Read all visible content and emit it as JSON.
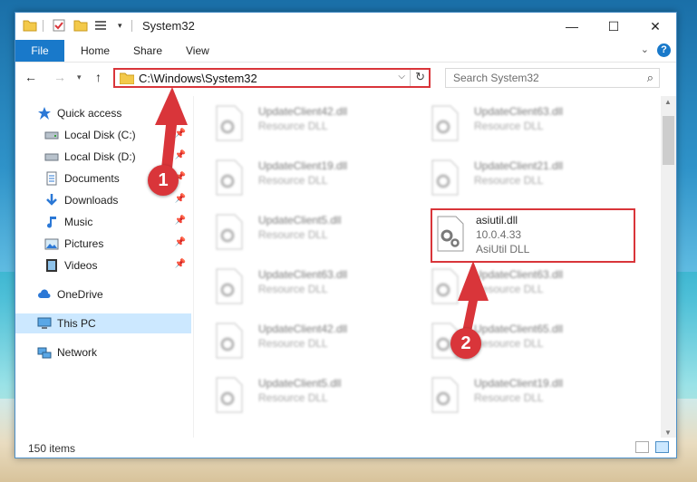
{
  "window": {
    "title": "System32",
    "controls": {
      "minimize": "—",
      "maximize": "☐",
      "close": "✕"
    }
  },
  "ribbon": {
    "file": "File",
    "tabs": [
      "Home",
      "Share",
      "View"
    ],
    "help": "?"
  },
  "address_bar": {
    "path": "C:\\Windows\\System32"
  },
  "search": {
    "placeholder": "Search System32"
  },
  "nav_pane": {
    "quick_access": "Quick access",
    "items": [
      "Local Disk (C:)",
      "Local Disk (D:)",
      "Documents",
      "Downloads",
      "Music",
      "Pictures",
      "Videos"
    ],
    "onedrive": "OneDrive",
    "this_pc": "This PC",
    "network": "Network"
  },
  "files": {
    "left": [
      {
        "name": "UpdateClient42.dll",
        "type": "Resource DLL"
      },
      {
        "name": "UpdateClient19.dll",
        "type": "Resource DLL"
      },
      {
        "name": "UpdateClient5.dll",
        "type": "Resource DLL"
      },
      {
        "name": "UpdateClient63.dll",
        "type": "Resource DLL"
      },
      {
        "name": "UpdateClient42.dll",
        "type": "Resource DLL"
      },
      {
        "name": "UpdateClient5.dll",
        "type": "Resource DLL"
      }
    ],
    "right": [
      {
        "name": "UpdateClient63.dll",
        "type": "Resource DLL"
      },
      {
        "name": "UpdateClient21.dll",
        "type": "Resource DLL"
      },
      {
        "name": "UpdateClient63.dll",
        "type": "Resource DLL"
      },
      {
        "name": "UpdateClient65.dll",
        "type": "Resource DLL"
      },
      {
        "name": "UpdateClient19.dll",
        "type": "Resource DLL"
      }
    ],
    "highlighted": {
      "name": "asiutil.dll",
      "version": "10.0.4.33",
      "type": "AsiUtil DLL"
    }
  },
  "status_bar": {
    "item_count": "150 items"
  },
  "annotations": {
    "step1": "1",
    "step2": "2",
    "color": "#d9353a"
  }
}
